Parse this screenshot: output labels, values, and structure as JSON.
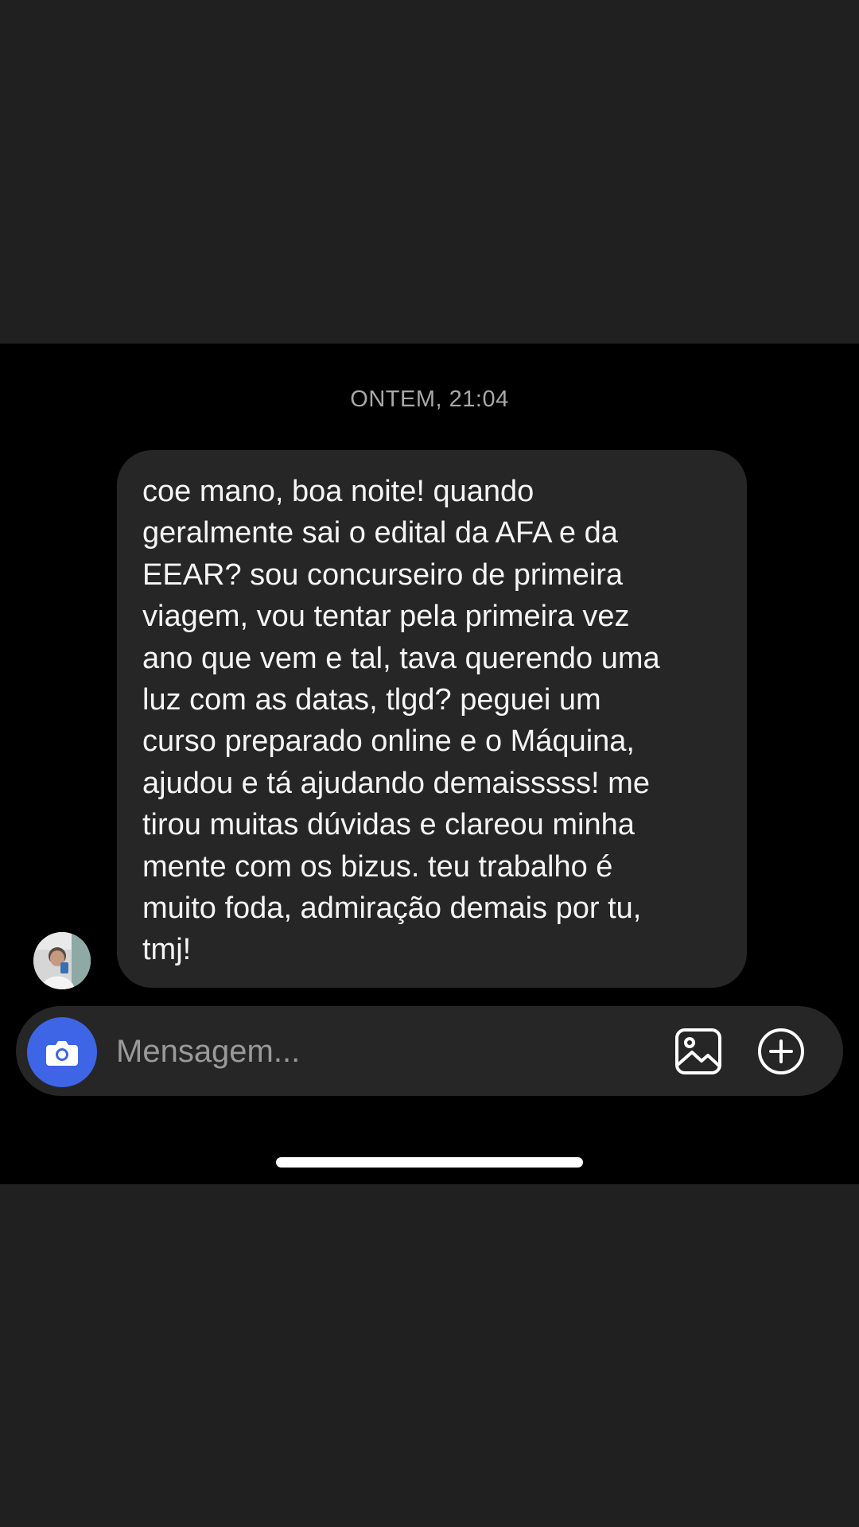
{
  "chat": {
    "timestamp": "ONTEM, 21:04",
    "messages": [
      {
        "sender": "other",
        "text": "coe mano, boa noite! quando\ngeralmente sai o edital da AFA e da\nEEAR? sou concurseiro de primeira\nviagem, vou tentar pela primeira vez\nano que vem e tal, tava querendo uma\nluz com as datas, tlgd? peguei um\ncurso preparado online e o Máquina,\najudou e tá ajudando demaisssss! me\ntirou muitas dúvidas e clareou minha\nmente com os bizus. teu trabalho é\nmuito foda, admiração demais por tu,\ntmj!"
      }
    ]
  },
  "composer": {
    "placeholder": "Mensagem...",
    "value": "",
    "camera_icon": "camera-icon",
    "gallery_icon": "image-icon",
    "plus_icon": "plus-circle-icon",
    "camera_color": "#3e65e6"
  },
  "colors": {
    "background": "#000000",
    "letterbox": "#202020",
    "bubble": "#262626",
    "text": "#f5f5f5",
    "timestamp": "#a8a8a8"
  }
}
